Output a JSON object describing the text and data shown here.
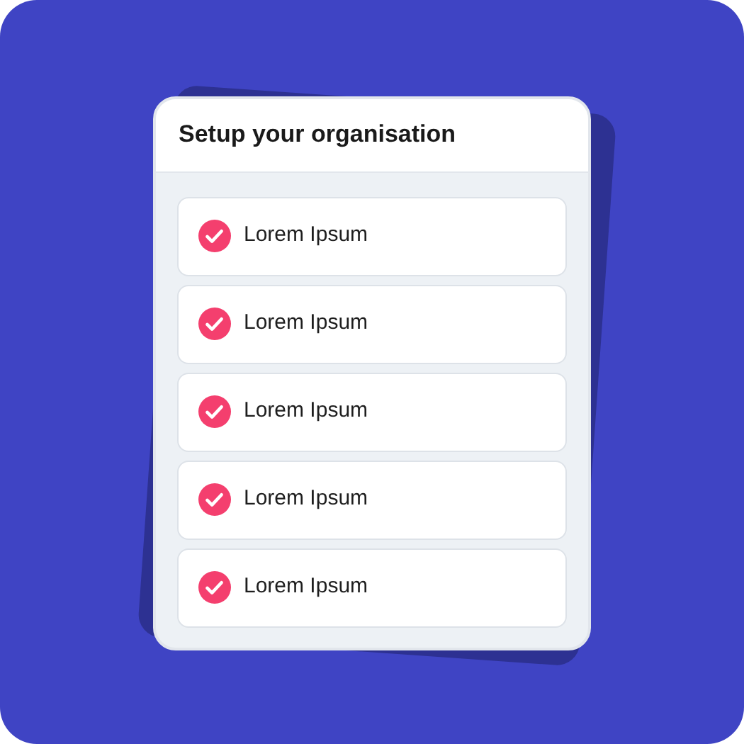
{
  "card": {
    "title": "Setup your organisation",
    "items": [
      {
        "label": "Lorem Ipsum",
        "checked": true
      },
      {
        "label": "Lorem Ipsum",
        "checked": true
      },
      {
        "label": "Lorem Ipsum",
        "checked": true
      },
      {
        "label": "Lorem Ipsum",
        "checked": true
      },
      {
        "label": "Lorem Ipsum",
        "checked": true
      }
    ]
  }
}
